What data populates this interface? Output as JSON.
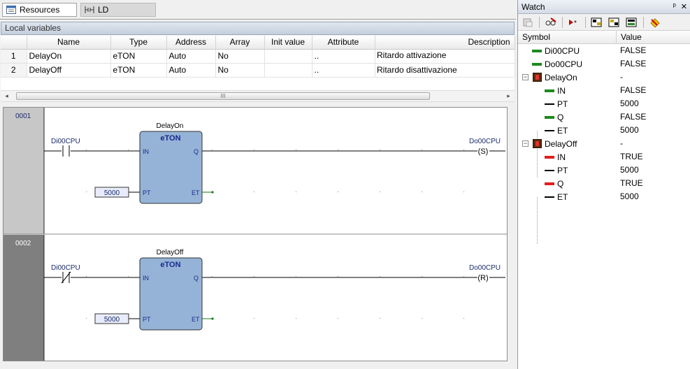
{
  "tabs": [
    {
      "label": "Resources",
      "icon": "resources-icon"
    },
    {
      "label": "LD",
      "icon": "ladder-icon"
    }
  ],
  "local_variables": {
    "title": "Local variables",
    "columns": [
      "Name",
      "Type",
      "Address",
      "Array",
      "Init value",
      "Attribute",
      "Description"
    ],
    "rows": [
      {
        "num": "1",
        "name": "DelayOn",
        "type": "eTON",
        "address": "Auto",
        "array": "No",
        "init": "",
        "attribute": "..",
        "description": "Ritardo attivazione"
      },
      {
        "num": "2",
        "name": "DelayOff",
        "type": "eTON",
        "address": "Auto",
        "array": "No",
        "init": "",
        "attribute": "..",
        "description": "Ritardo disattivazione"
      }
    ],
    "scroll_left": "◂",
    "scroll_right": "▸",
    "scroll_grip": "III"
  },
  "ladder": {
    "rungs": [
      {
        "number": "0001",
        "block_instance": "DelayOn",
        "block_type": "eTON",
        "pin_in": "IN",
        "pin_q": "Q",
        "pin_pt": "PT",
        "pin_et": "ET",
        "contact_label": "Di00CPU",
        "contact_type": "NO",
        "coil_label": "Do00CPU",
        "coil_type": "(S)",
        "pt_value": "5000"
      },
      {
        "number": "0002",
        "block_instance": "DelayOff",
        "block_type": "eTON",
        "pin_in": "IN",
        "pin_q": "Q",
        "pin_pt": "PT",
        "pin_et": "ET",
        "contact_label": "Di00CPU",
        "contact_type": "NC",
        "coil_label": "Do00CPU",
        "coil_type": "(R)",
        "pt_value": "5000"
      }
    ]
  },
  "watch": {
    "title": "Watch",
    "pin_glyph": "ᵖ",
    "close_glyph": "✕",
    "toolbar_icons": [
      "watch-settings-icon",
      "watch-remove-icon",
      "watch-add-icon",
      "watch-load-icon",
      "watch-save-icon",
      "watch-export-icon",
      "watch-clear-icon"
    ],
    "columns": {
      "symbol": "Symbol",
      "value": "Value"
    },
    "items": [
      {
        "symbol": "Di00CPU",
        "value": "FALSE",
        "level": 0,
        "indicator": "green"
      },
      {
        "symbol": "Do00CPU",
        "value": "FALSE",
        "level": 0,
        "indicator": "green"
      },
      {
        "symbol": "DelayOn",
        "value": "-",
        "level": 0,
        "indicator": "fb",
        "expander": "−"
      },
      {
        "symbol": "IN",
        "value": "FALSE",
        "level": 1,
        "indicator": "green"
      },
      {
        "symbol": "PT",
        "value": "5000",
        "level": 1,
        "indicator": "black"
      },
      {
        "symbol": "Q",
        "value": "FALSE",
        "level": 1,
        "indicator": "green"
      },
      {
        "symbol": "ET",
        "value": "5000",
        "level": 1,
        "indicator": "black"
      },
      {
        "symbol": "DelayOff",
        "value": "-",
        "level": 0,
        "indicator": "fb",
        "expander": "−"
      },
      {
        "symbol": "IN",
        "value": "TRUE",
        "level": 1,
        "indicator": "red"
      },
      {
        "symbol": "PT",
        "value": "5000",
        "level": 1,
        "indicator": "black"
      },
      {
        "symbol": "Q",
        "value": "TRUE",
        "level": 1,
        "indicator": "red"
      },
      {
        "symbol": "ET",
        "value": "5000",
        "level": 1,
        "indicator": "black"
      }
    ]
  }
}
